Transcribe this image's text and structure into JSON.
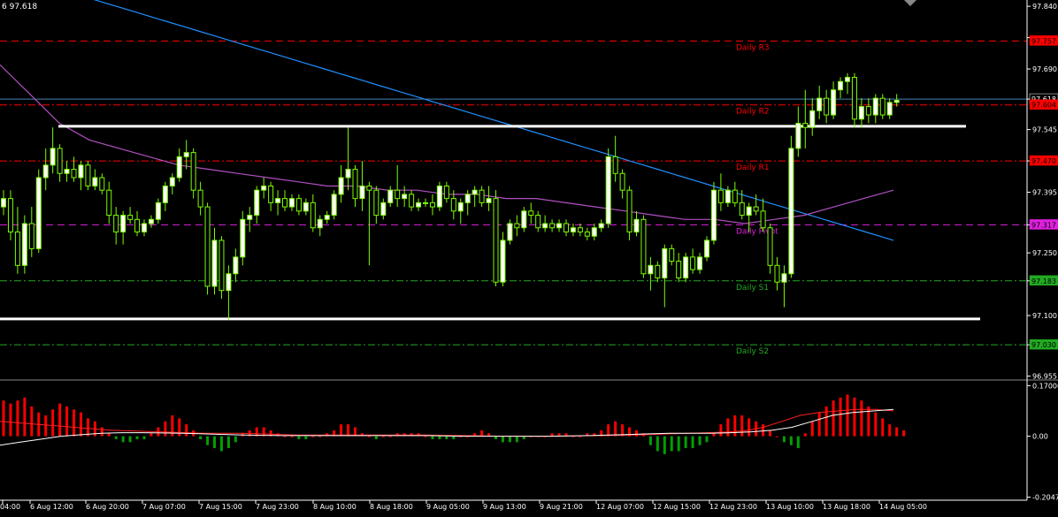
{
  "header": {
    "info_text": "6 97.618"
  },
  "colors": {
    "background": "#000000",
    "grid": "#ffffff",
    "bull_candle": "#ffffff",
    "bear_candle": "#000000",
    "wick": "#7cfc00",
    "ma_blue": "#1e90ff",
    "ma_violet": "#b050c0",
    "pivot_red": "#ff0000",
    "pivot_magenta": "#e020e0",
    "support_green": "#22aa22",
    "hist_pos": "#ff0000",
    "hist_neg": "#00a000",
    "signal_white": "#ffffff",
    "signal_red": "#ff2020"
  },
  "price_axis": {
    "ticks": [
      "97.840",
      "97.760",
      "97.690",
      "97.618",
      "97.545",
      "97.470",
      "97.395",
      "97.317",
      "97.250",
      "97.183",
      "97.100",
      "97.030",
      "96.955"
    ],
    "tick_values": [
      97.84,
      97.765,
      97.69,
      97.618,
      97.545,
      97.47,
      97.395,
      97.317,
      97.25,
      97.183,
      97.1,
      97.03,
      96.955
    ],
    "tick_labels_drawn": [
      "97.840",
      "97.690",
      "97.545",
      "97.395",
      "97.250",
      "97.100",
      "96.955"
    ],
    "range": [
      96.95,
      97.855
    ]
  },
  "price_tags": [
    {
      "label": "97.757",
      "value": 97.757,
      "color": "#ff0000",
      "text_color": "#000000"
    },
    {
      "label": "97.618",
      "value": 97.618,
      "color": "#000000",
      "text_color": "#ffffff"
    },
    {
      "label": "97.604",
      "value": 97.604,
      "color": "#ff0000",
      "text_color": "#000000"
    },
    {
      "label": "97.470",
      "value": 97.47,
      "color": "#ff0000",
      "text_color": "#000000"
    },
    {
      "label": "97.317",
      "value": 97.317,
      "color": "#e020e0",
      "text_color": "#000000"
    },
    {
      "label": "97.183",
      "value": 97.183,
      "color": "#22aa22",
      "text_color": "#000000"
    },
    {
      "label": "97.030",
      "value": 97.03,
      "color": "#22aa22",
      "text_color": "#000000"
    }
  ],
  "levels": [
    {
      "name": "Daily R3",
      "value": 97.757,
      "color": "#ff0000",
      "style": "dash"
    },
    {
      "name": "Daily R2",
      "value": 97.604,
      "color": "#ff0000",
      "style": "dashdot"
    },
    {
      "name": "Daily R1",
      "value": 97.47,
      "color": "#ff0000",
      "style": "dashdot"
    },
    {
      "name": "Daily Pivot",
      "value": 97.317,
      "color": "#e020e0",
      "style": "dash"
    },
    {
      "name": "Daily S1",
      "value": 97.183,
      "color": "#22aa22",
      "style": "dashdot"
    },
    {
      "name": "Daily S2",
      "value": 97.03,
      "color": "#22aa22",
      "style": "dashdot"
    }
  ],
  "trendlines": [
    {
      "name": "resistance",
      "value": 97.553,
      "from_bar": 7,
      "to_bar": 123
    },
    {
      "name": "support",
      "value": 97.092,
      "from_bar": 0,
      "to_bar": 124
    }
  ],
  "time_axis": {
    "labels": [
      "04:00",
      "6 Aug 12:00",
      "6 Aug 20:00",
      "7 Aug 07:00",
      "7 Aug 15:00",
      "7 Aug 23:00",
      "8 Aug 10:00",
      "8 Aug 18:00",
      "9 Aug 05:00",
      "9 Aug 13:00",
      "9 Aug 21:00",
      "12 Aug 07:00",
      "12 Aug 15:00",
      "12 Aug 23:00",
      "13 Aug 10:00",
      "13 Aug 18:00",
      "14 Aug 05:00"
    ],
    "label_bars": [
      0,
      7,
      15,
      23,
      31,
      39,
      47,
      55,
      63,
      71,
      79,
      87,
      95,
      103,
      111,
      119,
      127
    ]
  },
  "oscillator": {
    "ticks": [
      "0.17006",
      "0.00",
      "-0.2047"
    ],
    "tick_values": [
      0.17006,
      0.0,
      -0.2047
    ],
    "range": [
      -0.215,
      0.18
    ]
  },
  "chart_data": {
    "type": "candlestick",
    "candles": [
      [
        97.36,
        97.4,
        97.34,
        97.38
      ],
      [
        97.38,
        97.4,
        97.28,
        97.3
      ],
      [
        97.3,
        97.36,
        97.2,
        97.22
      ],
      [
        97.22,
        97.34,
        97.2,
        97.32
      ],
      [
        97.32,
        97.36,
        97.24,
        97.26
      ],
      [
        97.26,
        97.45,
        97.25,
        97.43
      ],
      [
        97.43,
        97.5,
        97.4,
        97.46
      ],
      [
        97.46,
        97.55,
        97.44,
        97.5
      ],
      [
        97.5,
        97.51,
        97.42,
        97.44
      ],
      [
        97.44,
        97.47,
        97.42,
        97.45
      ],
      [
        97.45,
        97.48,
        97.42,
        97.43
      ],
      [
        97.43,
        97.47,
        97.4,
        97.46
      ],
      [
        97.46,
        97.47,
        97.4,
        97.41
      ],
      [
        97.41,
        97.45,
        97.4,
        97.43
      ],
      [
        97.43,
        97.44,
        97.39,
        97.4
      ],
      [
        97.4,
        97.42,
        97.32,
        97.34
      ],
      [
        97.34,
        97.36,
        97.27,
        97.3
      ],
      [
        97.3,
        97.35,
        97.27,
        97.34
      ],
      [
        97.34,
        97.36,
        97.32,
        97.33
      ],
      [
        97.33,
        97.35,
        97.29,
        97.3
      ],
      [
        97.3,
        97.33,
        97.29,
        97.32
      ],
      [
        97.32,
        97.34,
        97.31,
        97.33
      ],
      [
        97.33,
        97.38,
        97.32,
        97.37
      ],
      [
        97.37,
        97.42,
        97.35,
        97.41
      ],
      [
        97.41,
        97.44,
        97.39,
        97.43
      ],
      [
        97.43,
        97.5,
        97.42,
        97.48
      ],
      [
        97.48,
        97.52,
        97.45,
        97.49
      ],
      [
        97.49,
        97.5,
        97.38,
        97.4
      ],
      [
        97.4,
        97.42,
        97.34,
        97.36
      ],
      [
        97.36,
        97.37,
        97.15,
        97.17
      ],
      [
        97.17,
        97.31,
        97.15,
        97.28
      ],
      [
        97.28,
        97.29,
        97.14,
        97.16
      ],
      [
        97.16,
        97.22,
        97.09,
        97.2
      ],
      [
        97.2,
        97.26,
        97.18,
        97.24
      ],
      [
        97.24,
        97.35,
        97.22,
        97.33
      ],
      [
        97.33,
        97.36,
        97.3,
        97.34
      ],
      [
        97.34,
        97.41,
        97.32,
        97.4
      ],
      [
        97.4,
        97.43,
        97.38,
        97.41
      ],
      [
        97.41,
        97.42,
        97.35,
        97.37
      ],
      [
        97.37,
        97.4,
        97.34,
        97.38
      ],
      [
        97.38,
        97.4,
        97.35,
        97.36
      ],
      [
        97.36,
        97.39,
        97.35,
        97.38
      ],
      [
        97.38,
        97.39,
        97.34,
        97.35
      ],
      [
        97.35,
        97.38,
        97.34,
        97.37
      ],
      [
        97.37,
        97.39,
        97.3,
        97.31
      ],
      [
        97.31,
        97.34,
        97.29,
        97.33
      ],
      [
        97.33,
        97.35,
        97.32,
        97.34
      ],
      [
        97.34,
        97.4,
        97.33,
        97.39
      ],
      [
        97.39,
        97.46,
        97.37,
        97.43
      ],
      [
        97.43,
        97.55,
        97.4,
        97.45
      ],
      [
        97.45,
        97.46,
        97.36,
        97.38
      ],
      [
        97.38,
        97.47,
        97.35,
        97.41
      ],
      [
        97.41,
        97.42,
        97.22,
        97.4
      ],
      [
        97.4,
        97.41,
        97.32,
        97.34
      ],
      [
        97.34,
        97.38,
        97.33,
        97.37
      ],
      [
        97.37,
        97.41,
        97.36,
        97.4
      ],
      [
        97.4,
        97.46,
        97.36,
        97.38
      ],
      [
        97.38,
        97.41,
        97.36,
        97.39
      ],
      [
        97.39,
        97.4,
        97.35,
        97.36
      ],
      [
        97.36,
        97.38,
        97.35,
        97.37
      ],
      [
        97.37,
        97.38,
        97.36,
        97.37
      ],
      [
        97.37,
        97.39,
        97.34,
        97.36
      ],
      [
        97.36,
        97.42,
        97.35,
        97.41
      ],
      [
        97.41,
        97.42,
        97.37,
        97.38
      ],
      [
        97.38,
        97.4,
        97.33,
        97.35
      ],
      [
        97.35,
        97.38,
        97.32,
        97.37
      ],
      [
        97.37,
        97.4,
        97.34,
        97.39
      ],
      [
        97.39,
        97.41,
        97.36,
        97.4
      ],
      [
        97.4,
        97.41,
        97.36,
        97.37
      ],
      [
        97.37,
        97.41,
        97.35,
        97.38
      ],
      [
        97.38,
        97.4,
        97.17,
        97.18
      ],
      [
        97.18,
        97.3,
        97.17,
        97.28
      ],
      [
        97.28,
        97.33,
        97.27,
        97.32
      ],
      [
        97.32,
        97.34,
        97.29,
        97.31
      ],
      [
        97.31,
        97.36,
        97.3,
        97.35
      ],
      [
        97.35,
        97.37,
        97.32,
        97.34
      ],
      [
        97.34,
        97.35,
        97.3,
        97.31
      ],
      [
        97.31,
        97.34,
        97.3,
        97.32
      ],
      [
        97.32,
        97.33,
        97.3,
        97.31
      ],
      [
        97.31,
        97.33,
        97.3,
        97.32
      ],
      [
        97.32,
        97.33,
        97.29,
        97.3
      ],
      [
        97.3,
        97.32,
        97.29,
        97.31
      ],
      [
        97.31,
        97.32,
        97.29,
        97.3
      ],
      [
        97.3,
        97.31,
        97.28,
        97.29
      ],
      [
        97.29,
        97.32,
        97.28,
        97.31
      ],
      [
        97.31,
        97.33,
        97.3,
        97.32
      ],
      [
        97.32,
        97.5,
        97.31,
        97.48
      ],
      [
        97.48,
        97.53,
        97.42,
        97.44
      ],
      [
        97.44,
        97.45,
        97.38,
        97.4
      ],
      [
        97.4,
        97.41,
        97.28,
        97.3
      ],
      [
        97.3,
        97.35,
        97.29,
        97.33
      ],
      [
        97.33,
        97.34,
        97.19,
        97.2
      ],
      [
        97.2,
        97.24,
        97.16,
        97.22
      ],
      [
        97.22,
        97.23,
        97.18,
        97.19
      ],
      [
        97.19,
        97.27,
        97.12,
        97.26
      ],
      [
        97.26,
        97.27,
        97.22,
        97.23
      ],
      [
        97.23,
        97.25,
        97.18,
        97.19
      ],
      [
        97.19,
        97.25,
        97.18,
        97.24
      ],
      [
        97.24,
        97.26,
        97.2,
        97.21
      ],
      [
        97.21,
        97.25,
        97.2,
        97.24
      ],
      [
        97.24,
        97.29,
        97.23,
        97.28
      ],
      [
        97.28,
        97.42,
        97.27,
        97.4
      ],
      [
        97.4,
        97.44,
        97.35,
        97.37
      ],
      [
        97.37,
        97.41,
        97.36,
        97.4
      ],
      [
        97.4,
        97.42,
        97.36,
        97.37
      ],
      [
        97.37,
        97.4,
        97.33,
        97.34
      ],
      [
        97.34,
        97.37,
        97.3,
        97.36
      ],
      [
        97.36,
        97.39,
        97.34,
        97.35
      ],
      [
        97.35,
        97.38,
        97.3,
        97.31
      ],
      [
        97.31,
        97.32,
        97.2,
        97.22
      ],
      [
        97.22,
        97.24,
        97.16,
        97.18
      ],
      [
        97.18,
        97.22,
        97.12,
        97.2
      ],
      [
        97.2,
        97.53,
        97.19,
        97.5
      ],
      [
        97.5,
        97.6,
        97.48,
        97.56
      ],
      [
        97.56,
        97.64,
        97.5,
        97.55
      ],
      [
        97.55,
        97.62,
        97.53,
        97.59
      ],
      [
        97.59,
        97.65,
        97.57,
        97.62
      ],
      [
        97.62,
        97.64,
        97.56,
        97.58
      ],
      [
        97.58,
        97.66,
        97.57,
        97.64
      ],
      [
        97.64,
        97.67,
        97.62,
        97.66
      ],
      [
        97.66,
        97.68,
        97.63,
        97.67
      ],
      [
        97.67,
        97.68,
        97.55,
        97.57
      ],
      [
        97.57,
        97.62,
        97.55,
        97.6
      ],
      [
        97.6,
        97.62,
        97.56,
        97.58
      ],
      [
        97.58,
        97.63,
        97.56,
        97.62
      ],
      [
        97.62,
        97.63,
        97.57,
        97.58
      ],
      [
        97.58,
        97.62,
        97.57,
        97.61
      ],
      [
        97.61,
        97.63,
        97.6,
        97.615
      ]
    ],
    "ma_blue": [
      97.86,
      97.85,
      97.84,
      97.83,
      97.82,
      97.81,
      97.8,
      97.79,
      97.78,
      97.77,
      97.76,
      97.75,
      97.74,
      97.73,
      97.72,
      97.71,
      97.7,
      97.69,
      97.68,
      97.67,
      97.66,
      97.65,
      97.64,
      97.63,
      97.62,
      97.61,
      97.6,
      97.59,
      97.58,
      97.57,
      97.56,
      97.55,
      97.54,
      97.53,
      97.52,
      97.51,
      97.5,
      97.49,
      97.48,
      97.47,
      97.46,
      97.45,
      97.44,
      97.43,
      97.42,
      97.41,
      97.4,
      97.39,
      97.38,
      97.37,
      97.36,
      97.35,
      97.34,
      97.33,
      97.32,
      97.31,
      97.3,
      97.29,
      97.28
    ],
    "ma_violet": [
      97.7,
      97.63,
      97.56,
      97.52,
      97.5,
      97.48,
      97.46,
      97.45,
      97.44,
      97.43,
      97.42,
      97.41,
      97.41,
      97.4,
      97.4,
      97.39,
      97.39,
      97.38,
      97.38,
      97.37,
      97.36,
      97.35,
      97.34,
      97.33,
      97.33,
      97.32,
      97.33,
      97.34,
      97.36,
      97.38,
      97.4
    ],
    "histogram": [
      0.12,
      0.11,
      0.12,
      0.13,
      0.1,
      0.08,
      0.07,
      0.09,
      0.11,
      0.1,
      0.09,
      0.08,
      0.06,
      0.05,
      0.03,
      0.01,
      -0.01,
      -0.02,
      -0.02,
      -0.01,
      -0.01,
      0.01,
      0.03,
      0.05,
      0.07,
      0.06,
      0.04,
      0.02,
      -0.01,
      -0.03,
      -0.04,
      -0.05,
      -0.04,
      -0.02,
      0.01,
      0.02,
      0.03,
      0.03,
      0.02,
      0.01,
      0.0,
      0.0,
      -0.01,
      -0.01,
      0.0,
      0.0,
      0.01,
      0.02,
      0.04,
      0.04,
      0.03,
      0.01,
      0.0,
      -0.01,
      0.0,
      0.0,
      0.01,
      0.01,
      0.01,
      0.01,
      0.0,
      -0.01,
      -0.01,
      -0.01,
      -0.01,
      0.0,
      0.0,
      0.01,
      0.02,
      0.01,
      -0.01,
      -0.02,
      -0.02,
      -0.02,
      -0.01,
      0.0,
      0.0,
      0.0,
      0.01,
      0.01,
      0.01,
      0.0,
      0.0,
      0.01,
      0.01,
      0.02,
      0.04,
      0.05,
      0.04,
      0.03,
      0.02,
      0.01,
      -0.03,
      -0.05,
      -0.06,
      -0.05,
      -0.05,
      -0.04,
      -0.04,
      -0.03,
      -0.02,
      0.01,
      0.04,
      0.06,
      0.07,
      0.07,
      0.06,
      0.05,
      0.04,
      0.02,
      0.0,
      -0.02,
      -0.03,
      -0.04,
      0.01,
      0.05,
      0.08,
      0.1,
      0.12,
      0.13,
      0.14,
      0.13,
      0.12,
      0.1,
      0.08,
      0.06,
      0.04,
      0.03,
      0.02
    ],
    "signal_red": [
      0.05,
      0.045,
      0.04,
      0.035,
      0.03,
      0.025,
      0.02,
      0.018,
      0.016,
      0.014,
      0.012,
      0.01,
      0.01,
      0.01,
      0.008,
      0.006,
      0.004,
      0.004,
      0.004,
      0.004,
      0.004,
      0.004,
      0.004,
      0.004,
      0.003,
      0.002,
      0.001,
      0.0,
      0.0,
      0.0,
      0.0,
      0.001,
      0.002,
      0.003,
      0.004,
      0.006,
      0.008,
      0.01,
      0.012,
      0.014,
      0.018,
      0.03,
      0.05,
      0.07,
      0.08,
      0.085,
      0.09,
      0.09,
      0.085
    ],
    "signal_white": [
      -0.03,
      -0.02,
      -0.01,
      0.0,
      0.005,
      0.01,
      0.012,
      0.012,
      0.011,
      0.01,
      0.008,
      0.006,
      0.004,
      0.003,
      0.002,
      0.002,
      0.002,
      0.002,
      0.002,
      0.002,
      0.002,
      0.002,
      0.001,
      0.0,
      0.0,
      0.0,
      0.0,
      0.0,
      0.001,
      0.002,
      0.004,
      0.006,
      0.008,
      0.01,
      0.01,
      0.01,
      0.012,
      0.015,
      0.02,
      0.03,
      0.05,
      0.07,
      0.08,
      0.085,
      0.09
    ]
  }
}
